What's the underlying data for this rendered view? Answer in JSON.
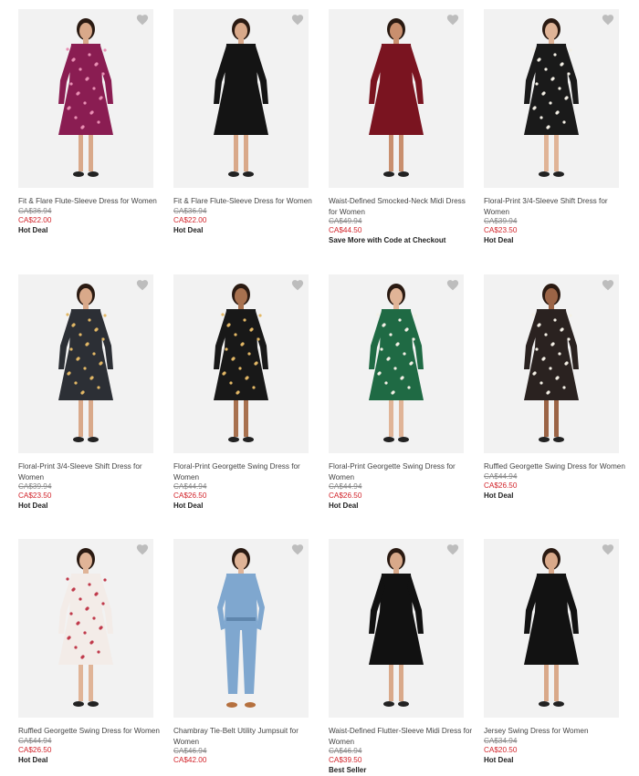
{
  "products": [
    {
      "title": "Fit & Flare Flute-Sleeve Dress for Women",
      "was": "CA$36.94",
      "now": "CA$22.00",
      "badge": "Hot Deal",
      "dress": "#8a1d52",
      "pattern": "floral",
      "legs": "#d9a98a"
    },
    {
      "title": "Fit & Flare Flute-Sleeve Dress for Women",
      "was": "CA$36.94",
      "now": "CA$22.00",
      "badge": "Hot Deal",
      "dress": "#141414",
      "pattern": "solid",
      "legs": "#d9a98a"
    },
    {
      "title": "Waist-Defined Smocked-Neck Midi Dress for Women",
      "was": "CA$49.94",
      "now": "CA$44.50",
      "badge": "Save More with Code at Checkout",
      "dress": "#7a1420",
      "pattern": "solid",
      "legs": "#c98f6e"
    },
    {
      "title": "Floral-Print 3/4-Sleeve Shift Dress for Women",
      "was": "CA$39.94",
      "now": "CA$23.50",
      "badge": "Hot Deal",
      "dress": "#1a1a1a",
      "pattern": "floral-light",
      "legs": "#e0b497"
    },
    {
      "title": "Floral-Print 3/4-Sleeve Shift Dress for Women",
      "was": "CA$39.94",
      "now": "CA$23.50",
      "badge": "Hot Deal",
      "dress": "#2c2f35",
      "pattern": "floral-gold",
      "legs": "#d9a98a"
    },
    {
      "title": "Floral-Print Georgette Swing Dress for Women",
      "was": "CA$44.94",
      "now": "CA$26.50",
      "badge": "Hot Deal",
      "dress": "#181818",
      "pattern": "floral-gold",
      "legs": "#a8714f"
    },
    {
      "title": "Floral-Print Georgette Swing Dress for Women",
      "was": "CA$44.94",
      "now": "CA$26.50",
      "badge": "Hot Deal",
      "dress": "#1f6a44",
      "pattern": "floral-light",
      "legs": "#e0b497"
    },
    {
      "title": "Ruffled Georgette Swing Dress for Women",
      "was": "CA$44.94",
      "now": "CA$26.50",
      "badge": "Hot Deal",
      "dress": "#2a2220",
      "pattern": "floral-light",
      "legs": "#9b6446"
    },
    {
      "title": "Ruffled Georgette Swing Dress for Women",
      "was": "CA$44.94",
      "now": "CA$26.50",
      "badge": "Hot Deal",
      "dress": "#f3ece8",
      "pattern": "floral-red",
      "legs": "#e0b497"
    },
    {
      "title": "Chambray Tie-Belt Utility Jumpsuit for Women",
      "was": "CA$46.94",
      "now": "CA$42.00",
      "badge": "",
      "dress": "#7fa7cf",
      "pattern": "jumpsuit",
      "legs": "#e0b497"
    },
    {
      "title": "Waist-Defined Flutter-Sleeve Midi Dress for Women",
      "was": "CA$46.94",
      "now": "CA$39.50",
      "badge": "Best Seller",
      "dress": "#111111",
      "pattern": "solid",
      "legs": "#d9a98a"
    },
    {
      "title": "Jersey Swing Dress for Women",
      "was": "CA$34.94",
      "now": "CA$20.50",
      "badge": "Hot Deal",
      "dress": "#121212",
      "pattern": "solid",
      "legs": "#d9a98a"
    }
  ]
}
